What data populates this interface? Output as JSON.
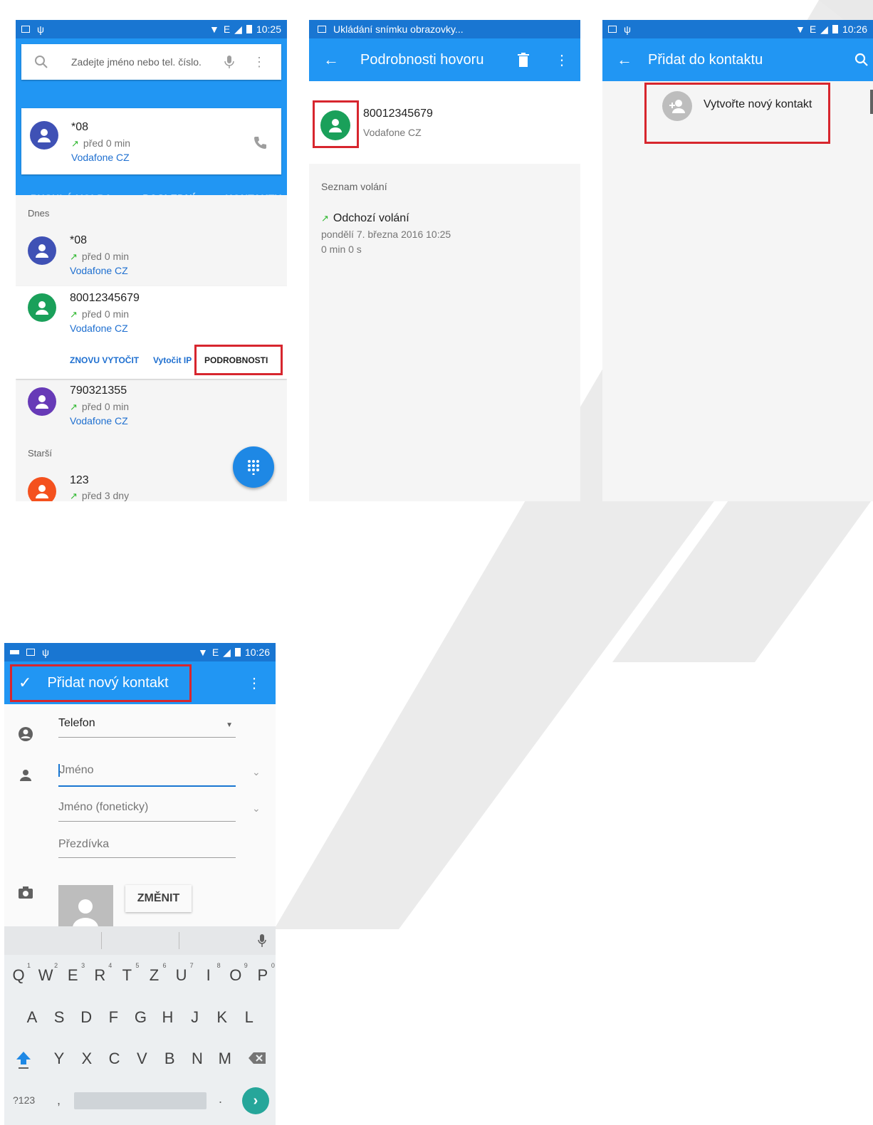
{
  "screen1": {
    "status_time": "10:25",
    "status_network": "E",
    "search_placeholder": "Zadejte jméno nebo tel. číslo.",
    "featured": {
      "name": "*08",
      "time": "před 0 min",
      "carrier": "Vodafone CZ"
    },
    "tabs": [
      "RYCHLÁ VOLBA",
      "POSLEDNÍ",
      "KONTAKTY"
    ],
    "section_today": "Dnes",
    "section_older": "Starší",
    "calls": [
      {
        "name": "*08",
        "time": "před 0 min",
        "carrier": "Vodafone CZ",
        "color": "#3f51b5"
      },
      {
        "name": "80012345679",
        "time": "před 0 min",
        "carrier": "Vodafone CZ",
        "color": "#1aa05a"
      },
      {
        "name": "790321355",
        "time": "před 0 min",
        "carrier": "Vodafone CZ",
        "color": "#673ab7"
      },
      {
        "name": "123",
        "time": "před 3 dny",
        "carrier": "",
        "color": "#f4511e"
      }
    ],
    "actions": {
      "redial": "ZNOVU VYTOČIT",
      "ip": "Vytočit IP",
      "details": "PODROBNOSTI"
    }
  },
  "screen2": {
    "status_text": "Ukládání snímku obrazovky...",
    "title": "Podrobnosti hovoru",
    "number": "80012345679",
    "carrier": "Vodafone CZ",
    "section": "Seznam volání",
    "call_type": "Odchozí volání",
    "call_date": "pondělí 7. března 2016 10:25",
    "duration": "0 min 0 s"
  },
  "screen3": {
    "status_time": "10:26",
    "status_network": "E",
    "title": "Přidat do kontaktu",
    "create_label": "Vytvořte nový kontakt"
  },
  "screen4": {
    "status_time": "10:26",
    "status_network": "E",
    "title": "Přidat nový kontakt",
    "account": "Telefon",
    "name_placeholder": "Jméno",
    "phonetic": "Jméno (foneticky)",
    "nickname": "Přezdívka",
    "change_button": "ZMĚNIT",
    "keyboard": {
      "row1": [
        "Q",
        "W",
        "E",
        "R",
        "T",
        "Z",
        "U",
        "I",
        "O",
        "P"
      ],
      "row1_nums": [
        "1",
        "2",
        "3",
        "4",
        "5",
        "6",
        "7",
        "8",
        "9",
        "0"
      ],
      "row2": [
        "A",
        "S",
        "D",
        "F",
        "G",
        "H",
        "J",
        "K",
        "L"
      ],
      "row3": [
        "Y",
        "X",
        "C",
        "V",
        "B",
        "N",
        "M"
      ],
      "symbols": "?123",
      "comma": ",",
      "period": "."
    }
  },
  "colors": {
    "primary": "#2196f3",
    "primary_dark": "#1976d2",
    "highlight": "#d7262e",
    "fab": "#1e88e5"
  }
}
